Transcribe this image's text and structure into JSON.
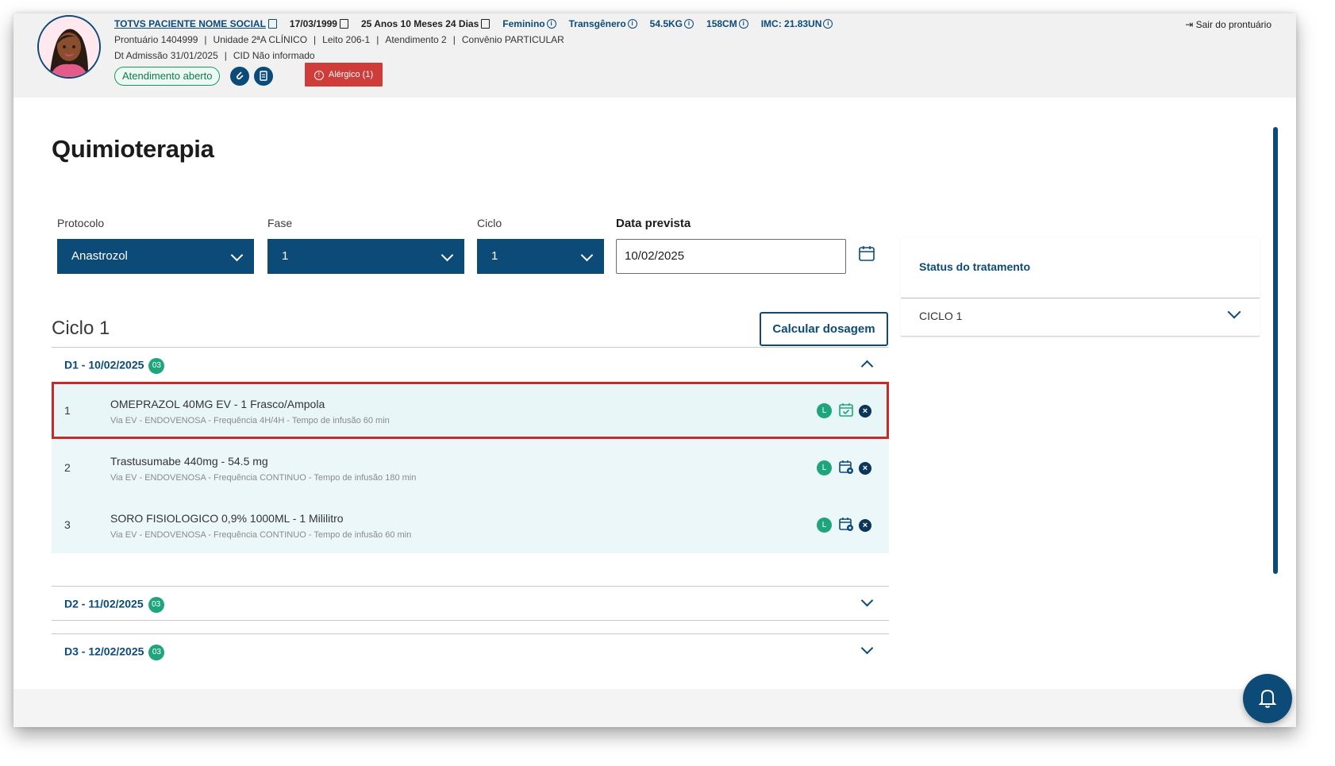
{
  "header": {
    "patient_name": "TOTVS PACIENTE NOME SOCIAL",
    "birth_date": "17/03/1999",
    "age": "25 Anos 10 Meses 24 Dias",
    "gender": "Feminino",
    "identity": "Transgênero",
    "weight": "54.5KG",
    "height": "158CM",
    "bmi": "IMC: 21.83UN",
    "prontuario": "Prontuário 1404999",
    "unidade": "Unidade 2ªA CLÍNICO",
    "leito": "Leito 206-1",
    "atendimento": "Atendimento 2",
    "convenio": "Convênio PARTICULAR",
    "admissao": "Dt Admissão 31/01/2025",
    "cid": "CID Não informado",
    "status_label": "Atendimento aberto",
    "allergy_label": "Alérgico (1)",
    "exit_label": "Sair do prontuário",
    "colors": {
      "primary": "#0c4a78",
      "allergy": "#cf3d3b",
      "success": "#1fa57d"
    }
  },
  "page": {
    "title": "Quimioterapia",
    "protocolo_label": "Protocolo",
    "protocolo_value": "Anastrozol",
    "fase_label": "Fase",
    "fase_value": "1",
    "ciclo_label": "Ciclo",
    "ciclo_value": "1",
    "data_label": "Data prevista",
    "data_value": "10/02/2025",
    "section_title": "Ciclo 1",
    "calc_button": "Calcular dosagem"
  },
  "days": [
    {
      "title": "D1 - 10/02/2025",
      "badge": "03"
    },
    {
      "title": "D2 - 11/02/2025",
      "badge": "03"
    },
    {
      "title": "D3 - 12/02/2025",
      "badge": "03"
    }
  ],
  "medications": [
    {
      "num": "1",
      "name": "OMEPRAZOL 40MG EV - 1 Frasco/Ampola",
      "desc": "Via EV - ENDOVENOSA - Frequência 4H/4H - Tempo de infusão 60 min",
      "tag": "L",
      "icon": "calendar-check-icon"
    },
    {
      "num": "2",
      "name": "Trastusumabe 440mg - 54.5 mg",
      "desc": "Via EV - ENDOVENOSA - Frequência CONTINUO - Tempo de infusão 180 min",
      "tag": "L",
      "icon": "calendar-gear-icon"
    },
    {
      "num": "3",
      "name": "SORO FISIOLOGICO 0,9% 1000ML - 1 Mililitro",
      "desc": "Via EV - ENDOVENOSA - Frequência CONTINUO - Tempo de infusão 60 min",
      "tag": "L",
      "icon": "calendar-gear-icon"
    }
  ],
  "status_panel": {
    "title": "Status do tratamento",
    "cycle": "CICLO 1"
  }
}
